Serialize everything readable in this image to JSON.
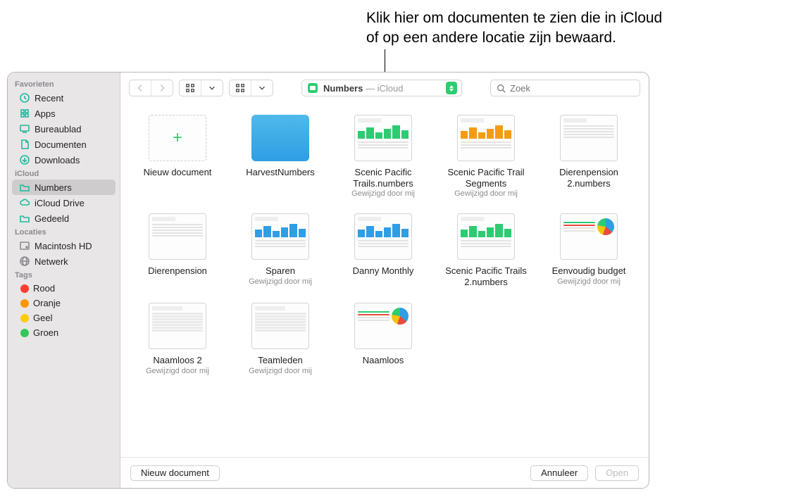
{
  "callout": {
    "line1": "Klik hier om documenten te zien die in iCloud",
    "line2": "of op een andere locatie zijn bewaard."
  },
  "sidebar": {
    "sections": [
      {
        "header": "Favorieten",
        "items": [
          {
            "label": "Recent",
            "icon": "clock-icon"
          },
          {
            "label": "Apps",
            "icon": "apps-icon"
          },
          {
            "label": "Bureaublad",
            "icon": "desktop-icon"
          },
          {
            "label": "Documenten",
            "icon": "doc-icon"
          },
          {
            "label": "Downloads",
            "icon": "download-icon"
          }
        ]
      },
      {
        "header": "iCloud",
        "items": [
          {
            "label": "Numbers",
            "icon": "folder-icon",
            "selected": true
          },
          {
            "label": "iCloud Drive",
            "icon": "cloud-icon"
          },
          {
            "label": "Gedeeld",
            "icon": "shared-icon"
          }
        ]
      },
      {
        "header": "Locaties",
        "items": [
          {
            "label": "Macintosh HD",
            "icon": "disk-icon",
            "grey": true
          },
          {
            "label": "Netwerk",
            "icon": "globe-icon",
            "grey": true
          }
        ]
      },
      {
        "header": "Tags",
        "items": [
          {
            "label": "Rood",
            "tag": "#ff3b30"
          },
          {
            "label": "Oranje",
            "tag": "#ff9500"
          },
          {
            "label": "Geel",
            "tag": "#ffcc00"
          },
          {
            "label": "Groen",
            "tag": "#34c759"
          }
        ]
      }
    ]
  },
  "toolbar": {
    "location_app": "Numbers",
    "location_sep": " — ",
    "location_place": "iCloud",
    "search_placeholder": "Zoek"
  },
  "items": [
    {
      "title": "Nieuw document",
      "sub": "",
      "thumb": "new"
    },
    {
      "title": "HarvestNumbers",
      "sub": "",
      "thumb": "folder"
    },
    {
      "title": "Scenic Pacific Trails.numbers",
      "sub": "Gewijzigd door mij",
      "thumb": "chart-green"
    },
    {
      "title": "Scenic Pacific Trail Segments",
      "sub": "Gewijzigd door mij",
      "thumb": "chart-orange"
    },
    {
      "title": "Dierenpension 2.numbers",
      "sub": "",
      "thumb": "text"
    },
    {
      "title": "Dierenpension",
      "sub": "",
      "thumb": "text"
    },
    {
      "title": "Sparen",
      "sub": "Gewijzigd door mij",
      "thumb": "chart-blue"
    },
    {
      "title": "Danny Monthly",
      "sub": "",
      "thumb": "chart-blue"
    },
    {
      "title": "Scenic Pacific Trails 2.numbers",
      "sub": "",
      "thumb": "chart-green"
    },
    {
      "title": "Eenvoudig budget",
      "sub": "Gewijzigd door mij",
      "thumb": "budget"
    },
    {
      "title": "Naamloos 2",
      "sub": "Gewijzigd door mij",
      "thumb": "table"
    },
    {
      "title": "Teamleden",
      "sub": "Gewijzigd door mij",
      "thumb": "table"
    },
    {
      "title": "Naamloos",
      "sub": "",
      "thumb": "budget"
    }
  ],
  "footer": {
    "new_doc": "Nieuw document",
    "cancel": "Annuleer",
    "open": "Open"
  }
}
